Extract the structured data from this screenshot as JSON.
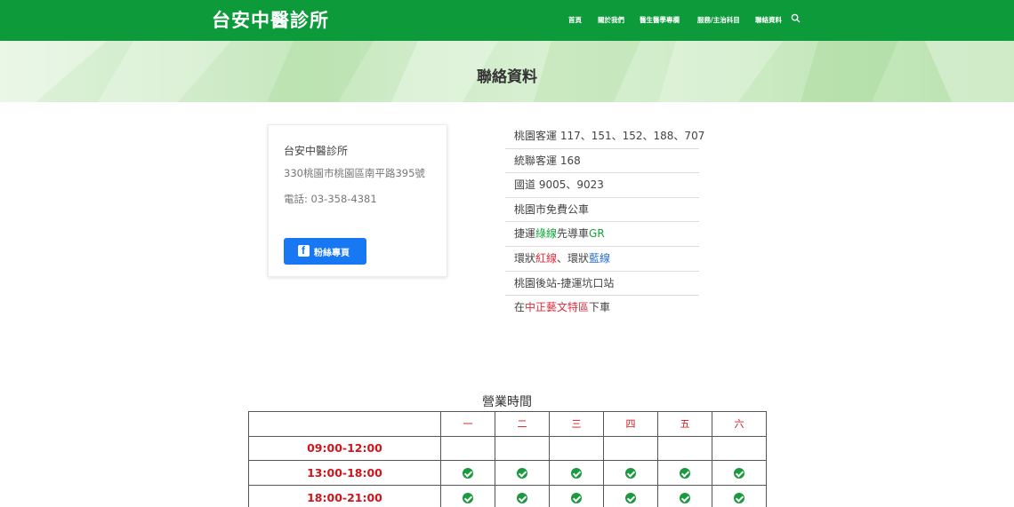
{
  "header": {
    "brand": "台安中醫診所",
    "nav": [
      "首頁",
      "關於我們",
      "醫生醫學專欄",
      "服務/主治科目",
      "聯絡資料"
    ],
    "search_icon": "search-icon"
  },
  "banner": {
    "title": "聯絡資料"
  },
  "card": {
    "name": "台安中醫診所",
    "address": "330桃園市桃園區南平路395號",
    "phone": "電話: 03-358-4381",
    "fb_button": "粉絲專頁",
    "fb_icon": "facebook-icon"
  },
  "transit": [
    [
      {
        "t": "桃園客運 117、151、152、188、707"
      }
    ],
    [
      {
        "t": "統聯客運 168"
      }
    ],
    [
      {
        "t": "國道 9005、9023"
      }
    ],
    [
      {
        "t": "桃園市免費公車"
      }
    ],
    [
      {
        "t": "捷運"
      },
      {
        "t": "綠線",
        "c": "green"
      },
      {
        "t": "先導車"
      },
      {
        "t": "GR",
        "c": "green"
      }
    ],
    [
      {
        "t": "環狀"
      },
      {
        "t": "紅線",
        "c": "red"
      },
      {
        "t": "、環狀"
      },
      {
        "t": "藍線",
        "c": "blue"
      }
    ],
    [
      {
        "t": "桃園後站-捷運坑口站"
      }
    ],
    [
      {
        "t": "在"
      },
      {
        "t": "中正藝文特區",
        "c": "red"
      },
      {
        "t": "下車"
      }
    ]
  ],
  "hours": {
    "title": "營業時間",
    "days": [
      "一",
      "二",
      "三",
      "四",
      "五",
      "六"
    ],
    "rows": [
      {
        "time": "09:00-12:00",
        "open": [
          false,
          false,
          false,
          false,
          false,
          false
        ]
      },
      {
        "time": "13:00-18:00",
        "open": [
          true,
          true,
          true,
          true,
          true,
          true
        ]
      },
      {
        "time": "18:00-21:00",
        "open": [
          true,
          true,
          true,
          true,
          true,
          true
        ]
      }
    ]
  },
  "colors": {
    "brand_green": "#0d9a3b",
    "fb_blue": "#1877f2",
    "time_red": "#d0141c",
    "check_green": "#1a9a3e"
  }
}
